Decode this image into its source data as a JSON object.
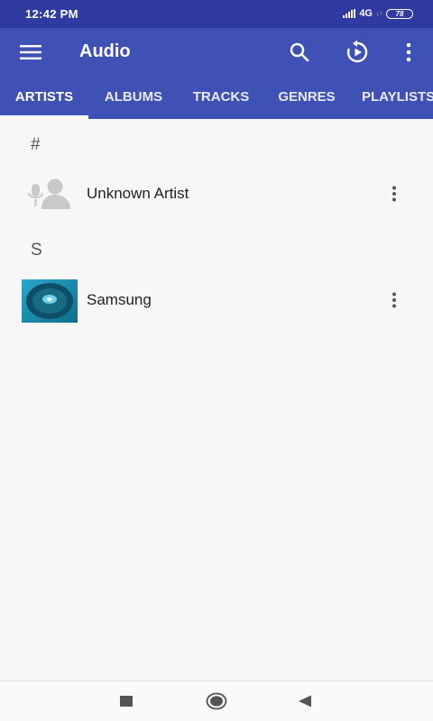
{
  "status_bar": {
    "time": "12:42 PM",
    "network": "4G",
    "battery": "78"
  },
  "app_bar": {
    "title": "Audio",
    "icons": [
      "menu-icon",
      "search-icon",
      "replay-icon",
      "more-vert-icon"
    ]
  },
  "tabs": [
    {
      "label": "ARTISTS",
      "active": true
    },
    {
      "label": "ALBUMS",
      "active": false
    },
    {
      "label": "TRACKS",
      "active": false
    },
    {
      "label": "GENRES",
      "active": false
    },
    {
      "label": "PLAYLISTS",
      "active": false
    }
  ],
  "sections": [
    {
      "header": "#",
      "items": [
        {
          "name": "Unknown Artist",
          "thumb": "artist-placeholder-icon"
        }
      ]
    },
    {
      "header": "S",
      "items": [
        {
          "name": "Samsung",
          "thumb": "artist-image"
        }
      ]
    }
  ],
  "nav_bar": {
    "icons": [
      "recents-icon",
      "home-icon",
      "back-icon"
    ]
  },
  "colors": {
    "status_bar": "#2f3ba0",
    "primary": "#3f51b5",
    "background": "#f7f7f7"
  }
}
